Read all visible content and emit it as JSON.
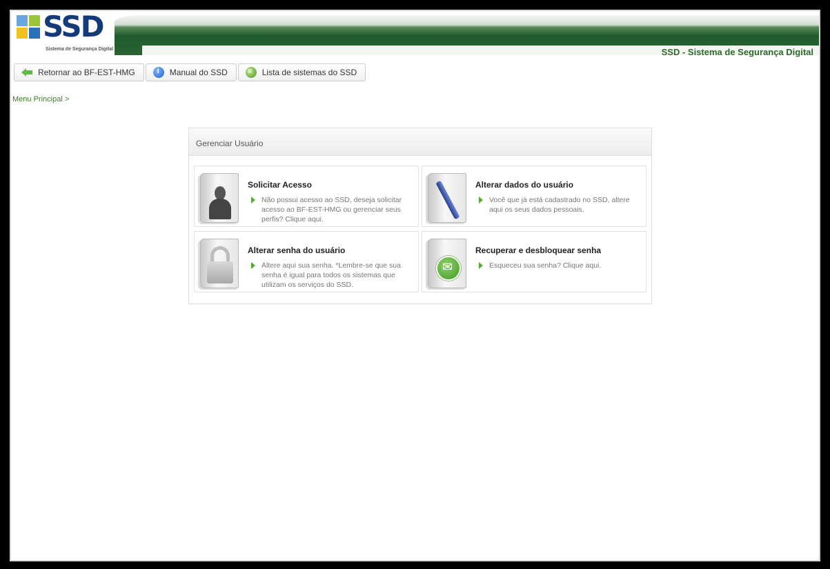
{
  "header": {
    "logo_text": "SSD",
    "logo_subtitle": "Sistema de Segurança Digital",
    "title": "SSD - Sistema de Segurança Digital"
  },
  "toolbar": {
    "back_label": "Retornar ao BF-EST-HMG",
    "manual_label": "Manual do SSD",
    "systems_label": "Lista de sistemas do SSD"
  },
  "breadcrumb": "Menu Principal >",
  "panel": {
    "title": "Gerenciar Usuário",
    "cards": [
      {
        "title": "Solicitar Acesso",
        "description": "Não possui acesso ao SSD, deseja solicitar acesso ao BF-EST-HMG ou gerenciar seus perfis? Clique aqui.",
        "icon": "user-document-icon"
      },
      {
        "title": "Alterar dados do usuário",
        "description": "Você que já está cadastrado no SSD, altere aqui os seus dados pessoais.",
        "icon": "edit-document-icon"
      },
      {
        "title": "Alterar senha do usuário",
        "description": "Altere aqui sua senha. *Lembre-se que sua senha é igual para todos os sistemas que utilizam os serviços do SSD.",
        "icon": "lock-document-icon"
      },
      {
        "title": "Recuperar e desbloquear senha",
        "description": "Esqueceu sua senha? Clique aqui.",
        "icon": "mail-document-icon"
      }
    ]
  },
  "colors": {
    "header_green": "#1f5a2c",
    "accent_green": "#3a7d2a",
    "logo_blue": "#153a7a"
  }
}
